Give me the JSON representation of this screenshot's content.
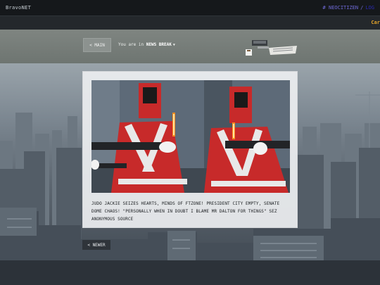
{
  "header": {
    "brand": "BravoNET",
    "neocitizen_label": "# NEOCITIZEN",
    "separator": "/",
    "user_label": "LOG"
  },
  "ticker": {
    "text": "Car"
  },
  "nav": {
    "main_label": "< MAIN",
    "location_prefix": "You are in",
    "section": "NEWS BREAK",
    "caret": "▼"
  },
  "article": {
    "headline": "JUDO JACKIE SEIZES HEARTS, MINDS OF FTZONE! PRESIDENT CITY EMPTY, SENATE DOME CHAOS! \"PERSONALLY WHEN IN DOUBT I BLAME MR DALTON FOR THINGS\" SEZ ANONYMOUS SOURCE"
  },
  "pagination": {
    "newer_label": "< NEWER"
  },
  "colors": {
    "topbar": "#15181b",
    "ticker_accent": "#e0a22a",
    "link_purple": "#6f6ad8",
    "suit_red": "#c72a2a"
  }
}
